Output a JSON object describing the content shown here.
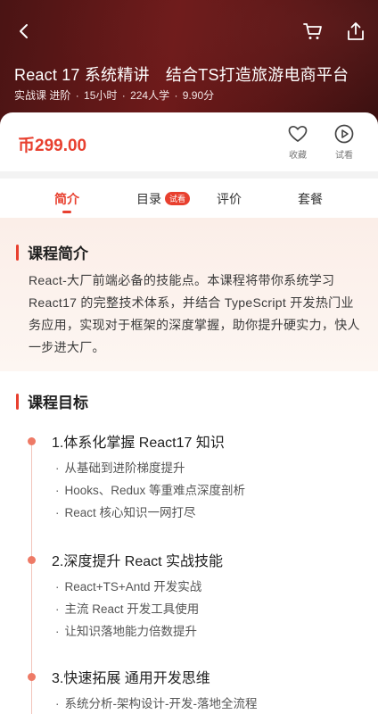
{
  "header": {
    "icons": [
      "back-icon",
      "cart-icon",
      "share-icon"
    ],
    "title": "React 17 系统精讲　结合TS打造旅游电商平台",
    "meta": [
      "实战课 进阶",
      "15小时",
      "224人学",
      "9.90分"
    ],
    "meta_separator": "·"
  },
  "purchase": {
    "price": "币299.00",
    "favorite_label": "收藏",
    "trial_label": "试看"
  },
  "tabs": [
    {
      "label": "简介",
      "active": true
    },
    {
      "label": "目录",
      "badge": "试看"
    },
    {
      "label": "评价"
    },
    {
      "label": "套餐"
    }
  ],
  "intro": {
    "title": "课程简介",
    "text": "React-大厂前端必备的技能点。本课程将带你系统学习 React17 的完整技术体系，并结合 TypeScript 开发热门业务应用，实现对于框架的深度掌握，助你提升硬实力，快人一步进大厂。"
  },
  "goals": {
    "title": "课程目标",
    "items": [
      {
        "title": "1.体系化掌握 React17 知识",
        "points": [
          "从基础到进阶梯度提升",
          "Hooks、Redux 等重难点深度剖析",
          "React 核心知识一网打尽"
        ]
      },
      {
        "title": "2.深度提升 React 实战技能",
        "points": [
          "React+TS+Antd 开发实战",
          "主流 React 开发工具使用",
          "让知识落地能力倍数提升"
        ]
      },
      {
        "title": "3.快速拓展 通用开发思维",
        "points": [
          "系统分析-架构设计-开发-落地全流程"
        ]
      }
    ]
  },
  "colors": {
    "accent": "#e8402f",
    "hero_dark": "#4a1414",
    "intro_bg": "#fbeee8",
    "timeline": "#f2c4bb"
  }
}
